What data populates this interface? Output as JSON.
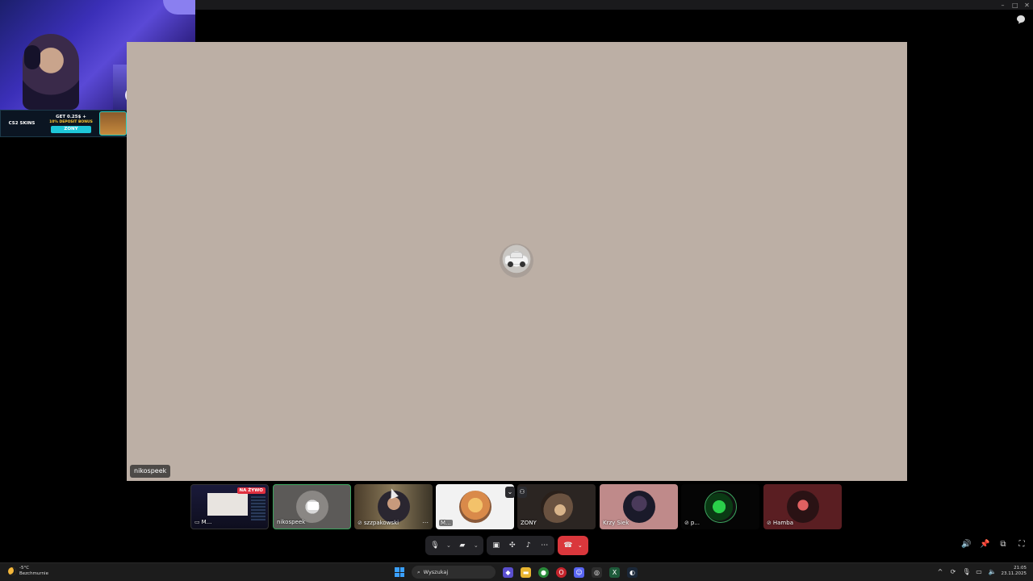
{
  "stage": {
    "participant_name": "nikospeek"
  },
  "ad": {
    "brand": "CS2 SKINS",
    "headline": "GET 0.25$ +",
    "bonus": "10% DEPOSIT BONUS",
    "code": "ZONY"
  },
  "tiles": [
    {
      "label": "M...",
      "badge": "NA ŻYWO",
      "muted": false
    },
    {
      "label": "nikospeek",
      "muted": false
    },
    {
      "label": "szzpakowski",
      "muted": true
    },
    {
      "label": "M...",
      "muted": false
    },
    {
      "label": "ZONY",
      "muted": false
    },
    {
      "label": "Krzy Siek",
      "muted": false
    },
    {
      "label": "p...",
      "muted": true
    },
    {
      "label": "Hamba",
      "muted": true
    }
  ],
  "taskbar": {
    "temperature": "-5°C",
    "weather": "Bezchmurnie",
    "search_placeholder": "Wyszukaj",
    "time": "21:05",
    "date": "23.11.2025"
  },
  "colors": {
    "stage_bg": "#bcafa5",
    "end_call": "#da373c",
    "speaking_border": "#3ba55d",
    "live_badge": "#e03040"
  }
}
